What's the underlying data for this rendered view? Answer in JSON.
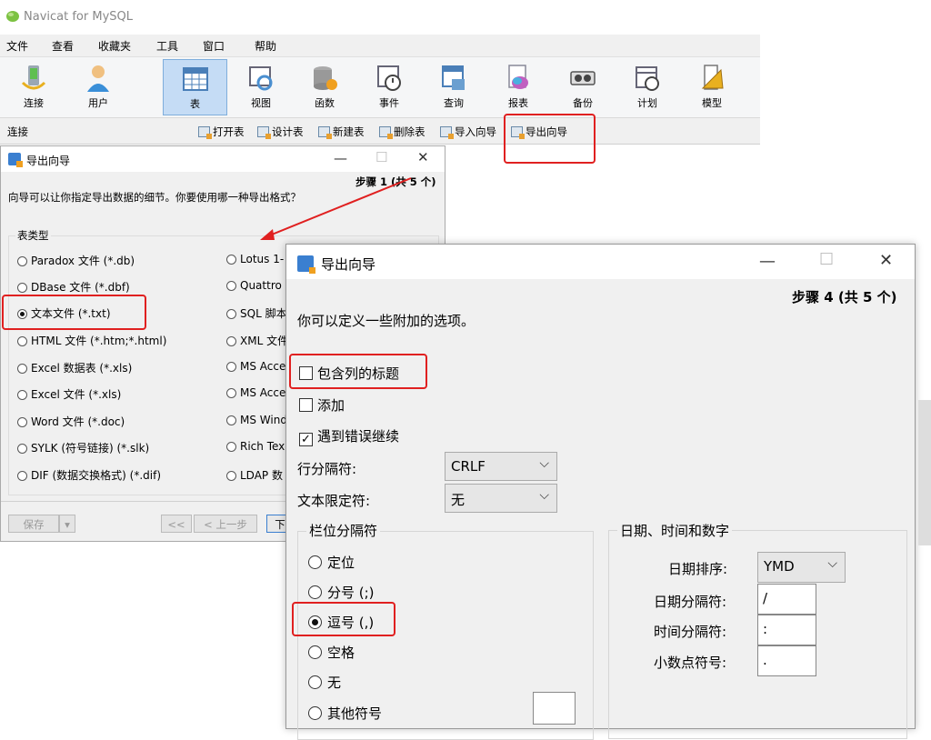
{
  "app": {
    "title": "Navicat for MySQL"
  },
  "menu": [
    "文件",
    "查看",
    "收藏夹",
    "工具",
    "窗口",
    "帮助"
  ],
  "toolbar": [
    "连接",
    "用户",
    "表",
    "视图",
    "函数",
    "事件",
    "查询",
    "报表",
    "备份",
    "计划",
    "模型"
  ],
  "subbar": {
    "left": "连接",
    "items": [
      "打开表",
      "设计表",
      "新建表",
      "删除表",
      "导入向导",
      "导出向导"
    ]
  },
  "dialog1": {
    "title": "导出向导",
    "step": "步骤 1 (共 5 个)",
    "question": "向导可以让你指定导出数据的细节。你要使用哪一种导出格式？",
    "group_label": "表类型",
    "left_options": [
      "Paradox 文件 (*.db)",
      "DBase 文件 (*.dbf)",
      "文本文件 (*.txt)",
      "HTML 文件 (*.htm;*.html)",
      "Excel 数据表 (*.xls)",
      "Excel 文件 (*.xls)",
      "Word 文件 (*.doc)",
      "SYLK (符号链接) (*.slk)",
      "DIF (数据交换格式) (*.dif)"
    ],
    "right_options": [
      "Lotus 1-",
      "Quattro",
      "SQL 脚本",
      "XML 文件",
      "MS Acce",
      "MS Acce",
      "MS Wind",
      "Rich Tex",
      "LDAP 数"
    ],
    "selected": "文本文件 (*.txt)",
    "buttons": {
      "save": "保存",
      "first": "<<",
      "prev": "< 上一步",
      "next": "下"
    }
  },
  "dialog2": {
    "title": "导出向导",
    "step": "步骤 4 (共 5 个)",
    "intro": "你可以定义一些附加的选项。",
    "checkboxes": [
      {
        "label": "包含列的标题",
        "checked": false
      },
      {
        "label": "添加",
        "checked": false
      },
      {
        "label": "遇到错误继续",
        "checked": true
      }
    ],
    "row_sep_label": "行分隔符:",
    "row_sep_value": "CRLF",
    "text_qual_label": "文本限定符:",
    "text_qual_value": "无",
    "field_sep": {
      "title": "栏位分隔符",
      "options": [
        "定位",
        "分号 (;)",
        "逗号 (,)",
        "空格",
        "无",
        "其他符号"
      ],
      "selected": "逗号 (,)"
    },
    "datetime": {
      "title": "日期、时间和数字",
      "date_order_label": "日期排序:",
      "date_order_value": "YMD",
      "date_sep_label": "日期分隔符:",
      "date_sep_value": "/",
      "time_sep_label": "时间分隔符:",
      "time_sep_value": ":",
      "decimal_label": "小数点符号:",
      "decimal_value": "."
    }
  },
  "colors": {
    "highlight": "#e02020",
    "accent": "#3a7fd0"
  }
}
